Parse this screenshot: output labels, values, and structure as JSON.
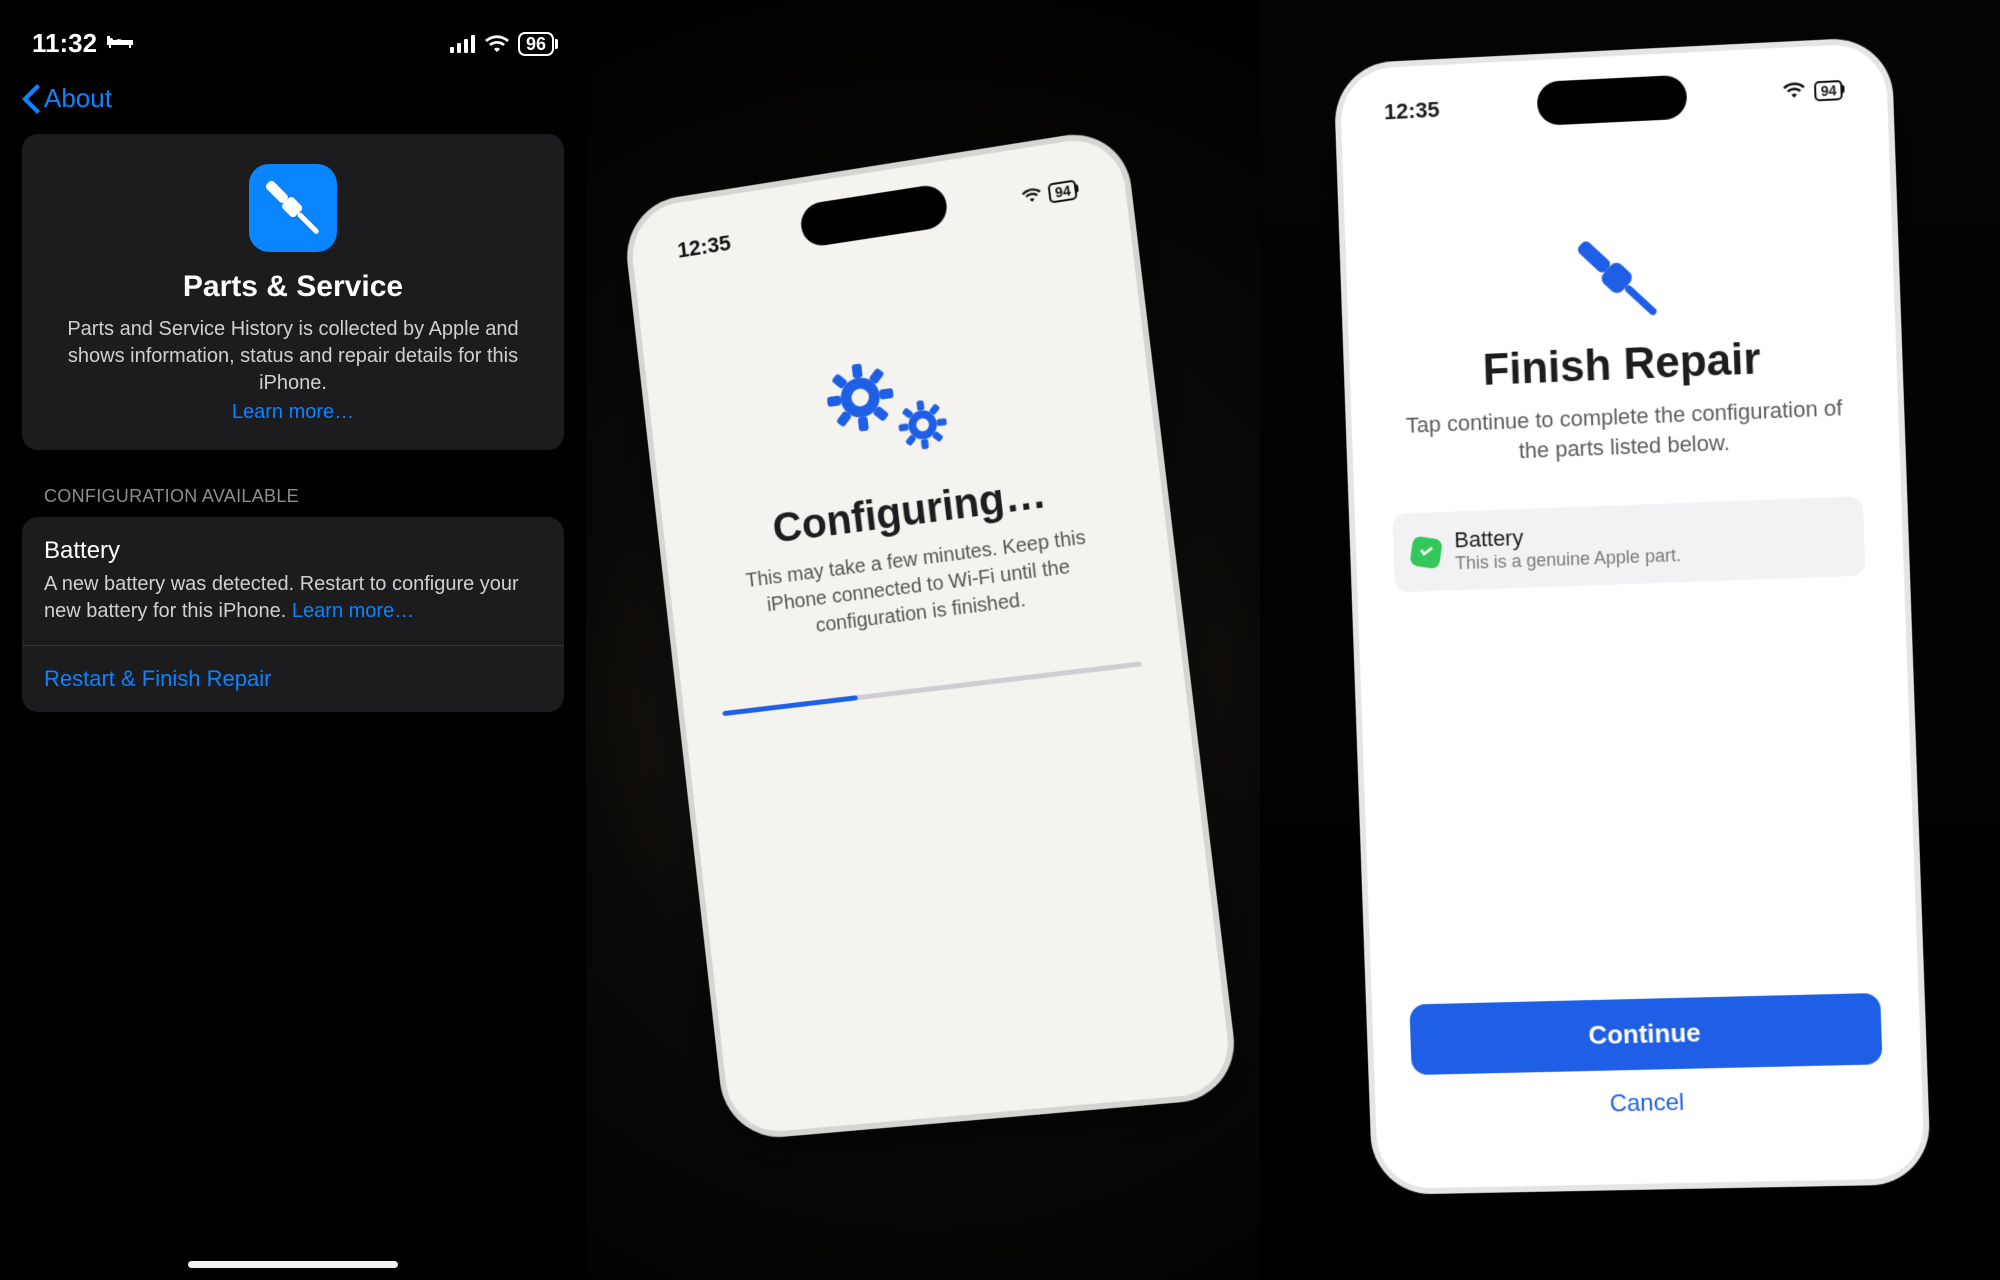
{
  "left": {
    "status": {
      "time": "11:32",
      "battery": "96"
    },
    "back_label": "About",
    "card": {
      "title": "Parts & Service",
      "desc": "Parts and Service History is collected by Apple and shows information, status and repair details for this iPhone.",
      "learn_more": "Learn more…"
    },
    "section_label": "CONFIGURATION AVAILABLE",
    "battery_row": {
      "title": "Battery",
      "body": "A new battery was detected. Restart to configure your new battery for this iPhone. ",
      "inline_link": "Learn more…"
    },
    "action_row": "Restart & Finish Repair"
  },
  "mid": {
    "status": {
      "time": "12:35",
      "battery": "94"
    },
    "title": "Configuring…",
    "desc": "This may take a few minutes. Keep this iPhone connected to Wi-Fi until the configuration is finished.",
    "progress_percent": 33
  },
  "right": {
    "status": {
      "time": "12:35",
      "battery": "94"
    },
    "title": "Finish Repair",
    "desc": "Tap continue to complete the configuration of the parts listed below.",
    "part": {
      "name": "Battery",
      "sub": "This is a genuine Apple part."
    },
    "continue": "Continue",
    "cancel": "Cancel"
  },
  "colors": {
    "ios_blue": "#0a84ff",
    "util_blue": "#1e5fe6",
    "green": "#34c759"
  }
}
